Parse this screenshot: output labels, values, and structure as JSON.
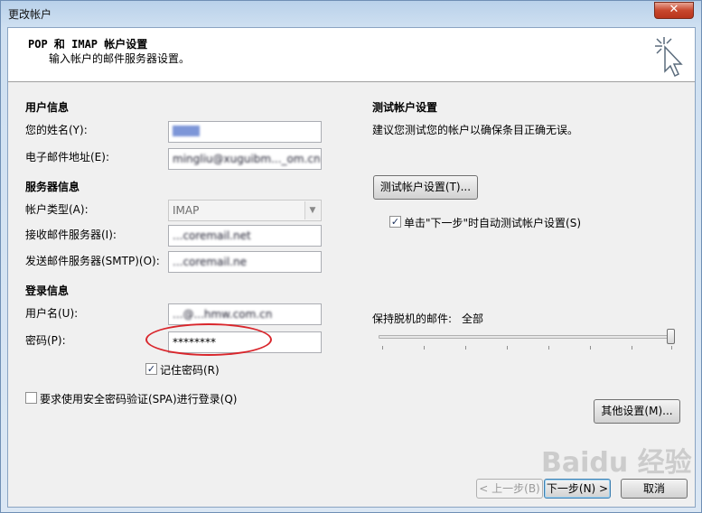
{
  "window": {
    "title": "更改帐户",
    "close_glyph": "✕"
  },
  "header": {
    "title": "POP 和 IMAP 帐户设置",
    "subtitle": "输入帐户的邮件服务器设置。",
    "icon": "wizard-cursor-icon"
  },
  "user_info": {
    "section": "用户信息",
    "name_label": "您的姓名(Y):",
    "name_value": "",
    "email_label": "电子邮件地址(E):",
    "email_value": "mingliu@xuguibm..._om.cn"
  },
  "server_info": {
    "section": "服务器信息",
    "account_type_label": "帐户类型(A):",
    "account_type_value": "IMAP",
    "incoming_label": "接收邮件服务器(I):",
    "incoming_value": "...coremail.net",
    "outgoing_label": "发送邮件服务器(SMTP)(O):",
    "outgoing_value": "...coremail.ne"
  },
  "login_info": {
    "section": "登录信息",
    "username_label": "用户名(U):",
    "username_value": "...@...hmw.com.cn",
    "password_label": "密码(P):",
    "password_value": "********",
    "remember_label": "记住密码(R)",
    "remember_checked": true,
    "spa_label": "要求使用安全密码验证(SPA)进行登录(Q)",
    "spa_checked": false
  },
  "test_settings": {
    "section": "测试帐户设置",
    "description": "建议您测试您的帐户以确保条目正确无误。",
    "test_button": "测试帐户设置(T)...",
    "auto_test_label": "单击\"下一步\"时自动测试帐户设置(S)",
    "auto_test_checked": true
  },
  "offline": {
    "label": "保持脱机的邮件:",
    "value": "全部",
    "slider_fraction": 1.0
  },
  "buttons": {
    "more_settings": "其他设置(M)...",
    "back": "< 上一步(B)",
    "next": "下一步(N) >",
    "cancel": "取消"
  },
  "watermark": "Baidu 经验"
}
